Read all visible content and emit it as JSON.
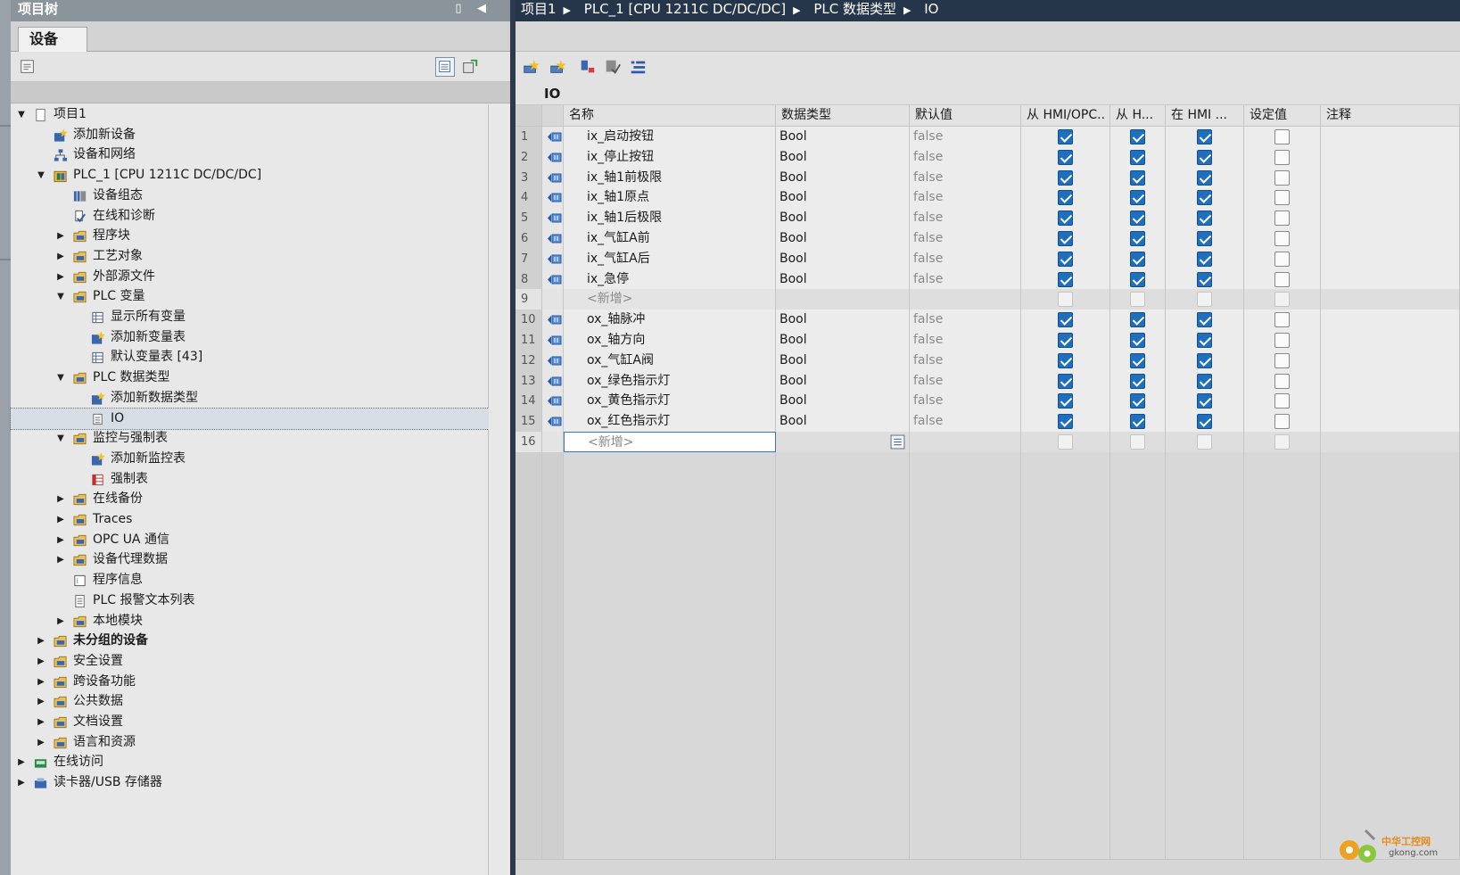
{
  "tree_panel": {
    "title": "项目树",
    "tab_devices": "设备",
    "items": [
      {
        "label": "项目1",
        "level": 0,
        "arrow": "down",
        "icon": "project-icon",
        "bold": false
      },
      {
        "label": "添加新设备",
        "level": 1,
        "arrow": "",
        "icon": "add-device-icon",
        "bold": false
      },
      {
        "label": "设备和网络",
        "level": 1,
        "arrow": "",
        "icon": "network-icon",
        "bold": false
      },
      {
        "label": "PLC_1 [CPU 1211C DC/DC/DC]",
        "level": 1,
        "arrow": "down",
        "icon": "plc-icon",
        "bold": false
      },
      {
        "label": "设备组态",
        "level": 2,
        "arrow": "",
        "icon": "device-config-icon",
        "bold": false
      },
      {
        "label": "在线和诊断",
        "level": 2,
        "arrow": "",
        "icon": "diagnostics-icon",
        "bold": false
      },
      {
        "label": "程序块",
        "level": 2,
        "arrow": "right",
        "icon": "folder-icon",
        "bold": false
      },
      {
        "label": "工艺对象",
        "level": 2,
        "arrow": "right",
        "icon": "folder-icon",
        "bold": false
      },
      {
        "label": "外部源文件",
        "level": 2,
        "arrow": "right",
        "icon": "folder-icon",
        "bold": false
      },
      {
        "label": "PLC 变量",
        "level": 2,
        "arrow": "down",
        "icon": "folder-icon",
        "bold": false
      },
      {
        "label": "显示所有变量",
        "level": 3,
        "arrow": "",
        "icon": "tag-table-icon",
        "bold": false
      },
      {
        "label": "添加新变量表",
        "level": 3,
        "arrow": "",
        "icon": "add-icon",
        "bold": false
      },
      {
        "label": "默认变量表 [43]",
        "level": 3,
        "arrow": "",
        "icon": "tag-table-icon",
        "bold": false
      },
      {
        "label": "PLC 数据类型",
        "level": 2,
        "arrow": "down",
        "icon": "folder-icon",
        "bold": false
      },
      {
        "label": "添加新数据类型",
        "level": 3,
        "arrow": "",
        "icon": "add-icon",
        "bold": false
      },
      {
        "label": "IO",
        "level": 3,
        "arrow": "",
        "icon": "datatype-icon",
        "bold": false,
        "selected": true
      },
      {
        "label": "监控与强制表",
        "level": 2,
        "arrow": "down",
        "icon": "folder-icon",
        "bold": false
      },
      {
        "label": "添加新监控表",
        "level": 3,
        "arrow": "",
        "icon": "add-icon",
        "bold": false
      },
      {
        "label": "强制表",
        "level": 3,
        "arrow": "",
        "icon": "force-table-icon",
        "bold": false
      },
      {
        "label": "在线备份",
        "level": 2,
        "arrow": "right",
        "icon": "folder-icon",
        "bold": false
      },
      {
        "label": "Traces",
        "level": 2,
        "arrow": "right",
        "icon": "folder-icon",
        "bold": false
      },
      {
        "label": "OPC UA 通信",
        "level": 2,
        "arrow": "right",
        "icon": "folder-icon",
        "bold": false
      },
      {
        "label": "设备代理数据",
        "level": 2,
        "arrow": "right",
        "icon": "folder-icon",
        "bold": false
      },
      {
        "label": "程序信息",
        "level": 2,
        "arrow": "",
        "icon": "info-icon",
        "bold": false
      },
      {
        "label": "PLC 报警文本列表",
        "level": 2,
        "arrow": "",
        "icon": "text-list-icon",
        "bold": false
      },
      {
        "label": "本地模块",
        "level": 2,
        "arrow": "right",
        "icon": "folder-icon",
        "bold": false
      },
      {
        "label": "未分组的设备",
        "level": 1,
        "arrow": "right",
        "icon": "folder-icon",
        "bold": true
      },
      {
        "label": "安全设置",
        "level": 1,
        "arrow": "right",
        "icon": "folder-icon",
        "bold": false
      },
      {
        "label": "跨设备功能",
        "level": 1,
        "arrow": "right",
        "icon": "folder-icon",
        "bold": false
      },
      {
        "label": "公共数据",
        "level": 1,
        "arrow": "right",
        "icon": "folder-icon",
        "bold": false
      },
      {
        "label": "文档设置",
        "level": 1,
        "arrow": "right",
        "icon": "folder-icon",
        "bold": false
      },
      {
        "label": "语言和资源",
        "level": 1,
        "arrow": "right",
        "icon": "folder-icon",
        "bold": false
      },
      {
        "label": "在线访问",
        "level": 0,
        "arrow": "right",
        "icon": "online-access-icon",
        "bold": false
      },
      {
        "label": "读卡器/USB 存储器",
        "level": 0,
        "arrow": "right",
        "icon": "card-reader-icon",
        "bold": false
      }
    ]
  },
  "breadcrumb": [
    "项目1",
    "PLC_1 [CPU 1211C DC/DC/DC]",
    "PLC 数据类型",
    "IO"
  ],
  "editor": {
    "title": "IO",
    "columns": [
      "名称",
      "数据类型",
      "默认值",
      "从 HMI/OPC..",
      "从 H...",
      "在 HMI ...",
      "设定值",
      "注释"
    ],
    "rows": [
      {
        "num": "1",
        "name": "ix_启动按钮",
        "type": "Bool",
        "default": "false",
        "c1": true,
        "c2": true,
        "c3": true,
        "c4": false
      },
      {
        "num": "2",
        "name": "ix_停止按钮",
        "type": "Bool",
        "default": "false",
        "c1": true,
        "c2": true,
        "c3": true,
        "c4": false
      },
      {
        "num": "3",
        "name": "ix_轴1前极限",
        "type": "Bool",
        "default": "false",
        "c1": true,
        "c2": true,
        "c3": true,
        "c4": false
      },
      {
        "num": "4",
        "name": "ix_轴1原点",
        "type": "Bool",
        "default": "false",
        "c1": true,
        "c2": true,
        "c3": true,
        "c4": false
      },
      {
        "num": "5",
        "name": "ix_轴1后极限",
        "type": "Bool",
        "default": "false",
        "c1": true,
        "c2": true,
        "c3": true,
        "c4": false
      },
      {
        "num": "6",
        "name": "ix_气缸A前",
        "type": "Bool",
        "default": "false",
        "c1": true,
        "c2": true,
        "c3": true,
        "c4": false
      },
      {
        "num": "7",
        "name": "ix_气缸A后",
        "type": "Bool",
        "default": "false",
        "c1": true,
        "c2": true,
        "c3": true,
        "c4": false
      },
      {
        "num": "8",
        "name": "ix_急停",
        "type": "Bool",
        "default": "false",
        "c1": true,
        "c2": true,
        "c3": true,
        "c4": false
      },
      {
        "num": "9",
        "name": "<新增>",
        "type": "",
        "default": "",
        "new": true
      },
      {
        "num": "10",
        "name": "ox_轴脉冲",
        "type": "Bool",
        "default": "false",
        "c1": true,
        "c2": true,
        "c3": true,
        "c4": false
      },
      {
        "num": "11",
        "name": "ox_轴方向",
        "type": "Bool",
        "default": "false",
        "c1": true,
        "c2": true,
        "c3": true,
        "c4": false
      },
      {
        "num": "12",
        "name": "ox_气缸A阀",
        "type": "Bool",
        "default": "false",
        "c1": true,
        "c2": true,
        "c3": true,
        "c4": false
      },
      {
        "num": "13",
        "name": "ox_绿色指示灯",
        "type": "Bool",
        "default": "false",
        "c1": true,
        "c2": true,
        "c3": true,
        "c4": false
      },
      {
        "num": "14",
        "name": "ox_黄色指示灯",
        "type": "Bool",
        "default": "false",
        "c1": true,
        "c2": true,
        "c3": true,
        "c4": false
      },
      {
        "num": "15",
        "name": "ox_红色指示灯",
        "type": "Bool",
        "default": "false",
        "c1": true,
        "c2": true,
        "c3": true,
        "c4": false
      },
      {
        "num": "16",
        "name": "<新增>",
        "type": "",
        "default": "",
        "new": true,
        "editing": true
      }
    ]
  },
  "watermark": {
    "line1": "中华工控网",
    "line2": "gkong.com"
  },
  "colors": {
    "accent": "#1f6fbf",
    "header_dark": "#25364a",
    "tree_header": "#8b939b"
  }
}
